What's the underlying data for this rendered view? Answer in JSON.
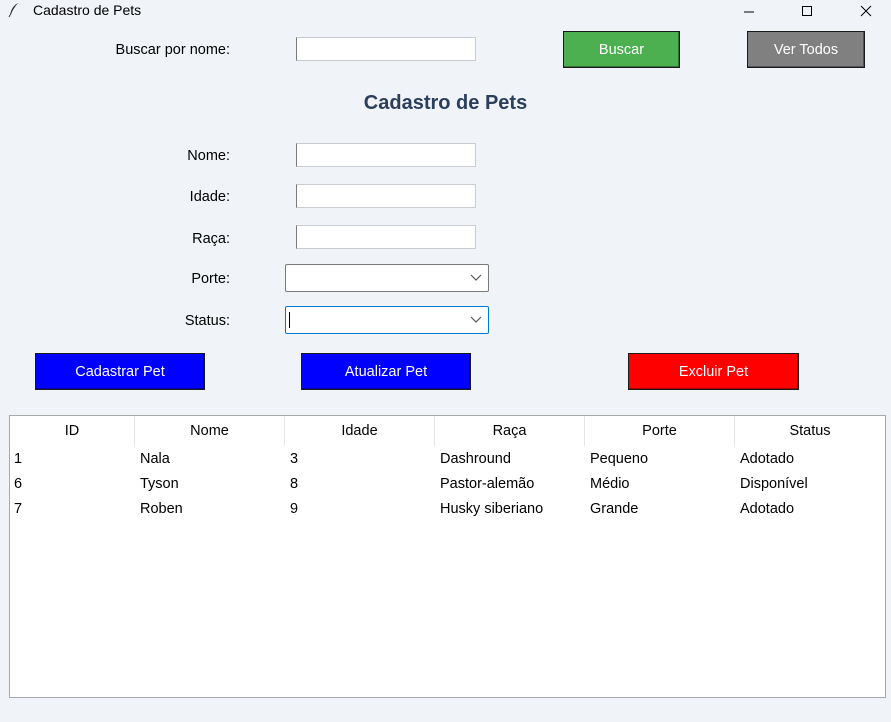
{
  "window": {
    "title": "Cadastro de Pets",
    "icon": "feather-icon"
  },
  "search": {
    "label": "Buscar por nome:",
    "value": "",
    "search_button": "Buscar",
    "view_all_button": "Ver Todos"
  },
  "heading": "Cadastro de Pets",
  "form": {
    "nome_label": "Nome:",
    "nome_value": "",
    "idade_label": "Idade:",
    "idade_value": "",
    "raca_label": "Raça:",
    "raca_value": "",
    "porte_label": "Porte:",
    "porte_value": "",
    "status_label": "Status:",
    "status_value": ""
  },
  "actions": {
    "cadastrar": "Cadastrar Pet",
    "atualizar": "Atualizar Pet",
    "excluir": "Excluir Pet"
  },
  "colors": {
    "buscar": "#4caf50",
    "ver_todos": "#808080",
    "cadastrar": "#0000ff",
    "atualizar": "#0000ff",
    "excluir": "#ff0000",
    "heading": "#2b3f5c"
  },
  "table": {
    "columns": [
      "ID",
      "Nome",
      "Idade",
      "Raça",
      "Porte",
      "Status"
    ],
    "rows": [
      [
        "1",
        "Nala",
        "3",
        "Dashround",
        "Pequeno",
        "Adotado"
      ],
      [
        "6",
        "Tyson",
        "8",
        "Pastor-alemão",
        "Médio",
        "Disponível"
      ],
      [
        "7",
        "Roben",
        "9",
        "Husky siberiano",
        "Grande",
        "Adotado"
      ]
    ]
  }
}
